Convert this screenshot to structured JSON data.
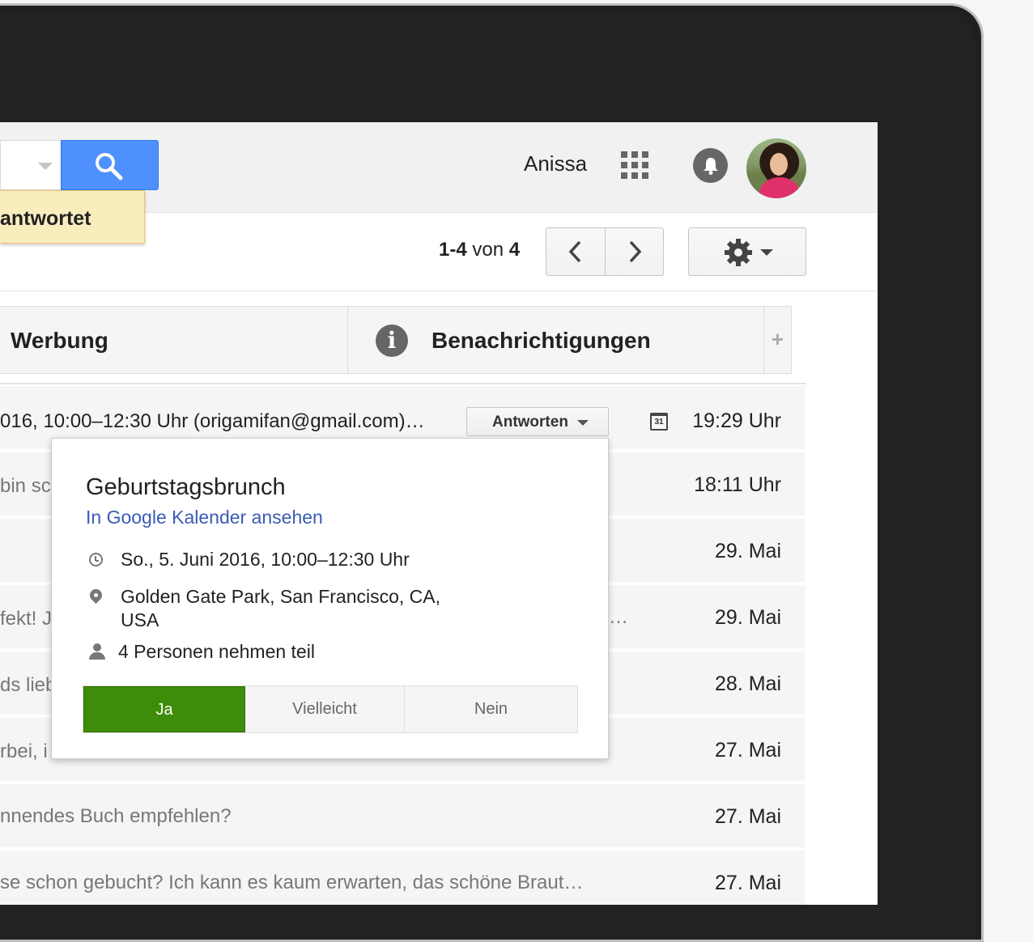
{
  "header": {
    "user_name": "Anissa"
  },
  "notice": {
    "text": "antwortet"
  },
  "toolbar": {
    "pager_range": "1-4",
    "pager_of": "von",
    "pager_total": "4"
  },
  "tabs": [
    {
      "label": "Werbung"
    },
    {
      "label": "Benachrichtigungen"
    }
  ],
  "add_tab_label": "+",
  "rows": [
    {
      "snippet": "016, 10:00–12:30 Uhr (origamifan@gmail.com)…",
      "date": "19:29 Uhr",
      "reply_label": "Antworten",
      "calendar_day": "31"
    },
    {
      "snippet": "bin sc",
      "date": "18:11 Uhr"
    },
    {
      "snippet": "",
      "date": "29. Mai"
    },
    {
      "snippet": "fekt! J",
      "trailing": "…",
      "date": "29. Mai"
    },
    {
      "snippet": "ds lieb",
      "date": "28. Mai"
    },
    {
      "snippet": "rbei, i",
      "date": "27. Mai"
    },
    {
      "snippet": "nnendes Buch empfehlen?",
      "date": "27. Mai"
    },
    {
      "snippet": "se schon gebucht? Ich kann es kaum erwarten, das schöne Braut…",
      "date": "27. Mai"
    }
  ],
  "event": {
    "title": "Geburtstagsbrunch",
    "calendar_link": "In Google Kalender ansehen",
    "time": "So., 5. Juni 2016, 10:00–12:30 Uhr",
    "location": "Golden Gate Park, San Francisco, CA, USA",
    "guests": "4 Personen nehmen teil",
    "rsvp": {
      "yes": "Ja",
      "maybe": "Vielleicht",
      "no": "Nein"
    }
  },
  "colors": {
    "search_button": "#4d90fe",
    "rsvp_yes": "#3d8c0a",
    "link": "#3b5bb5",
    "notice_bg": "#f9edbe"
  },
  "icons": [
    "search-icon",
    "apps-grid-icon",
    "notification-bell-icon",
    "info-icon",
    "chevron-left-icon",
    "chevron-right-icon",
    "gear-icon",
    "calendar-icon",
    "clock-icon",
    "location-pin-icon",
    "person-icon"
  ]
}
